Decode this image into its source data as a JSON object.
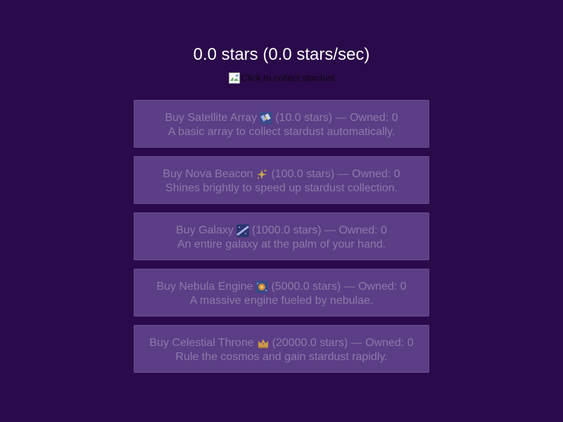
{
  "header": {
    "stars_text": "0.0 stars (0.0 stars/sec)"
  },
  "collect": {
    "alt_text": "Click to collect stardust",
    "icon": "broken-image-icon"
  },
  "shop": {
    "items": [
      {
        "buy_prefix": "Buy Satellite Array",
        "icon": "satellite-icon",
        "price_owned": "(10.0 stars) — Owned: 0",
        "description": "A basic array to collect stardust automatically.",
        "price": 10.0,
        "owned": 0
      },
      {
        "buy_prefix": "Buy Nova Beacon",
        "icon": "sparkles-icon",
        "price_owned": "(100.0 stars) — Owned: 0",
        "description": "Shines brightly to speed up stardust collection.",
        "price": 100.0,
        "owned": 0
      },
      {
        "buy_prefix": "Buy Galaxy",
        "icon": "milky-way-icon",
        "price_owned": "(1000.0 stars) — Owned: 0",
        "description": "An entire galaxy at the palm of your hand.",
        "price": 1000.0,
        "owned": 0
      },
      {
        "buy_prefix": "Buy Nebula Engine",
        "icon": "nebula-engine-icon",
        "price_owned": "(5000.0 stars) — Owned: 0",
        "description": "A massive engine fueled by nebulae.",
        "price": 5000.0,
        "owned": 0
      },
      {
        "buy_prefix": "Buy Celestial Throne",
        "icon": "crown-icon",
        "price_owned": "(20000.0 stars) — Owned: 0",
        "description": "Rule the cosmos and gain stardust rapidly.",
        "price": 20000.0,
        "owned": 0
      }
    ]
  },
  "colors": {
    "background": "#2a0a4a",
    "button_bg": "#5b3e86",
    "button_text": "#8d7aa8",
    "header_text": "#ffffff"
  }
}
